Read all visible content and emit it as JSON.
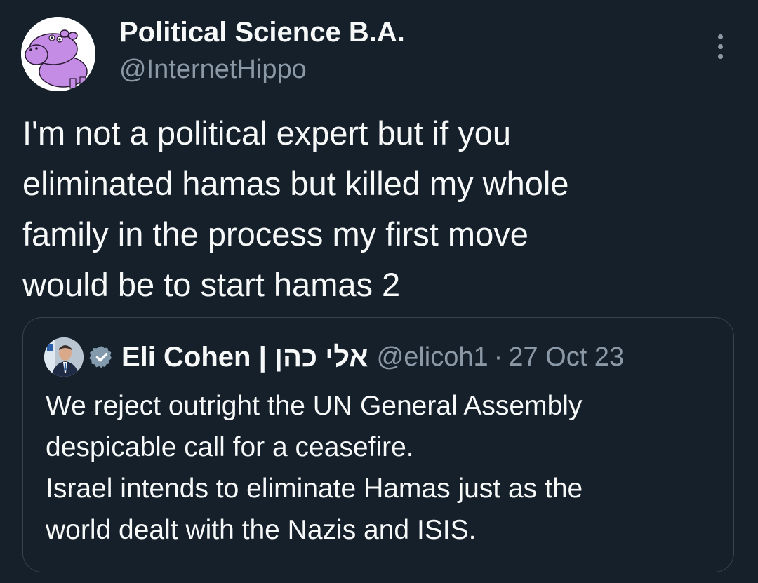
{
  "author": {
    "display_name": "Political Science B.A.",
    "handle": "@InternetHippo",
    "avatar_icon": "purple-hippo-avatar"
  },
  "menu": {
    "icon": "more-vertical-icon"
  },
  "tweet": {
    "text": "I'm not a political expert but if you\neliminated hamas but killed my whole\nfamily in the process my first move\nwould be to start hamas 2"
  },
  "quoted_tweet": {
    "display_name": "Eli Cohen | אלי כהן",
    "verified_icon": "verified-badge-icon",
    "handle": "@elicoh1",
    "separator": "·",
    "date": "27 Oct 23",
    "text": "We reject outright the UN General Assembly\ndespicable call for a ceasefire.\nIsrael intends to eliminate Hamas just as the\nworld dealt with the Nazis and ISIS."
  },
  "colors": {
    "background": "#15202b",
    "primary_text": "#f7f9f9",
    "secondary_text": "#8b98a5",
    "border": "#38444d",
    "avatar_purple": "#c58ce6",
    "verified_grey": "#829aab"
  }
}
